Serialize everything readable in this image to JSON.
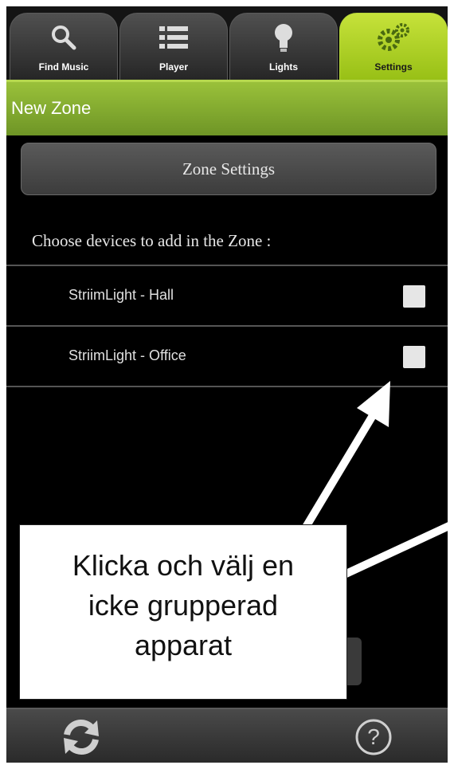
{
  "tabs": [
    {
      "label": "Find Music",
      "icon": "search-icon",
      "active": false
    },
    {
      "label": "Player",
      "icon": "list-icon",
      "active": false
    },
    {
      "label": "Lights",
      "icon": "bulb-icon",
      "active": false
    },
    {
      "label": "Settings",
      "icon": "gears-icon",
      "active": true
    }
  ],
  "header": {
    "title": "New Zone"
  },
  "zone_settings_label": "Zone Settings",
  "choose_label": "Choose devices to add in the Zone :",
  "devices": [
    {
      "name": "StriimLight - Hall",
      "checked": false
    },
    {
      "name": "StriimLight - Office",
      "checked": false
    }
  ],
  "callout": {
    "line1": "Klicka och välj en",
    "line2": "icke grupperad",
    "line3": "apparat"
  },
  "bottom": {
    "left_icon": "refresh-icon",
    "right_icon": "help-icon"
  },
  "colors": {
    "accent": "#9ac13a",
    "tab_active": "#b8d83a",
    "background": "#000000"
  }
}
